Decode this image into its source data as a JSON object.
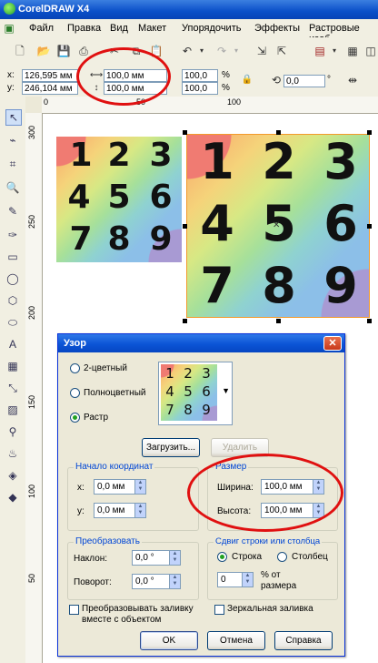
{
  "app": {
    "title": "CorelDRAW X4"
  },
  "menu": [
    "Файл",
    "Правка",
    "Вид",
    "Макет",
    "Упорядочить",
    "Эффекты",
    "Растровые изоб"
  ],
  "property_bar": {
    "x_label": "x:",
    "x_value": "126,595 мм",
    "y_label": "y:",
    "y_value": "246,104 мм",
    "width_value": "100,0 мм",
    "height_value": "100,0 мм",
    "scale_w": "100,0",
    "scale_h": "100,0",
    "percent": "%",
    "rotation": "0,0",
    "degree": "°"
  },
  "ruler": {
    "h_labels": [
      "0",
      "50",
      "100"
    ],
    "v_labels": [
      "300",
      "250",
      "200",
      "150",
      "100",
      "50"
    ]
  },
  "tiles": {
    "digits": [
      "1",
      "2",
      "3",
      "4",
      "5",
      "6",
      "7",
      "8",
      "9"
    ]
  },
  "dialog": {
    "title": "Узор",
    "radio_2color": "2-цветный",
    "radio_fullcolor": "Полноцветный",
    "radio_bitmap": "Растр",
    "load_button": "Загрузить...",
    "delete_button": "Удалить",
    "origin": {
      "title": "Начало координат",
      "x_label": "x:",
      "x_value": "0,0 мм",
      "y_label": "y:",
      "y_value": "0,0 мм"
    },
    "size": {
      "title": "Размер",
      "width_label": "Ширина:",
      "width_value": "100,0 мм",
      "height_label": "Высота:",
      "height_value": "100,0 мм"
    },
    "transform": {
      "title": "Преобразовать",
      "skew_label": "Наклон:",
      "skew_value": "0,0 °",
      "rotate_label": "Поворот:",
      "rotate_value": "0,0 °"
    },
    "offset": {
      "title": "Сдвиг строки или столбца",
      "row": "Строка",
      "column": "Столбец",
      "value": "0",
      "suffix_line1": "% от",
      "suffix_line2": "размера"
    },
    "transform_fill_line1": "Преобразовывать заливку",
    "transform_fill_line2": "вместе с объектом",
    "mirror_fill": "Зеркальная заливка",
    "ok": "OK",
    "cancel": "Отмена",
    "help": "Справка"
  }
}
